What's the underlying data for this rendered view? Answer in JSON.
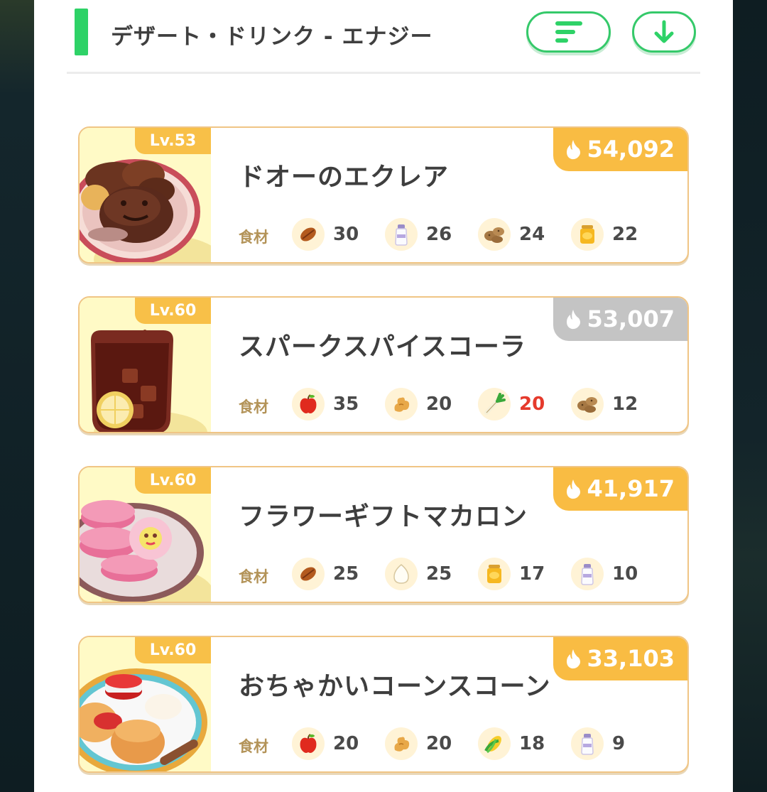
{
  "header": {
    "title": "デザート・ドリンク - エナジー",
    "sort_icon": "sort-lines-icon",
    "download_icon": "arrow-down-icon"
  },
  "colors": {
    "accent": "#2ed267",
    "energy_gold": "#f9bc43",
    "energy_gray": "#c4c4c4",
    "shortage": "#e53a2c",
    "level_badge": "#f8c048"
  },
  "ingredient_label": "食材",
  "recipes": [
    {
      "level": "Lv.53",
      "name": "ドオーのエクレア",
      "energy": "54,092",
      "energy_style": "gold",
      "image_icon": "eclair-dish-icon",
      "ingredients": [
        {
          "icon": "cacao-icon",
          "qty": "30",
          "short": false
        },
        {
          "icon": "milk-bottle-icon",
          "qty": "26",
          "short": false
        },
        {
          "icon": "potato-icon",
          "qty": "24",
          "short": false
        },
        {
          "icon": "honey-jar-icon",
          "qty": "22",
          "short": false
        }
      ]
    },
    {
      "level": "Lv.60",
      "name": "スパークスパイスコーラ",
      "energy": "53,007",
      "energy_style": "gray",
      "image_icon": "spice-cola-icon",
      "ingredients": [
        {
          "icon": "apple-icon",
          "qty": "35",
          "short": false
        },
        {
          "icon": "ginger-icon",
          "qty": "20",
          "short": false
        },
        {
          "icon": "leek-icon",
          "qty": "20",
          "short": true
        },
        {
          "icon": "potato-icon",
          "qty": "12",
          "short": false
        }
      ]
    },
    {
      "level": "Lv.60",
      "name": "フラワーギフトマカロン",
      "energy": "41,917",
      "energy_style": "gold",
      "image_icon": "macaron-dish-icon",
      "ingredients": [
        {
          "icon": "cacao-icon",
          "qty": "25",
          "short": false
        },
        {
          "icon": "egg-icon",
          "qty": "25",
          "short": false
        },
        {
          "icon": "honey-jar-icon",
          "qty": "17",
          "short": false
        },
        {
          "icon": "milk-bottle-icon",
          "qty": "10",
          "short": false
        }
      ]
    },
    {
      "level": "Lv.60",
      "name": "おちゃかいコーンスコーン",
      "energy": "33,103",
      "energy_style": "gold",
      "image_icon": "scone-dish-icon",
      "ingredients": [
        {
          "icon": "apple-icon",
          "qty": "20",
          "short": false
        },
        {
          "icon": "ginger-icon",
          "qty": "20",
          "short": false
        },
        {
          "icon": "corn-icon",
          "qty": "18",
          "short": false
        },
        {
          "icon": "milk-bottle-icon",
          "qty": "9",
          "short": false
        }
      ]
    }
  ]
}
